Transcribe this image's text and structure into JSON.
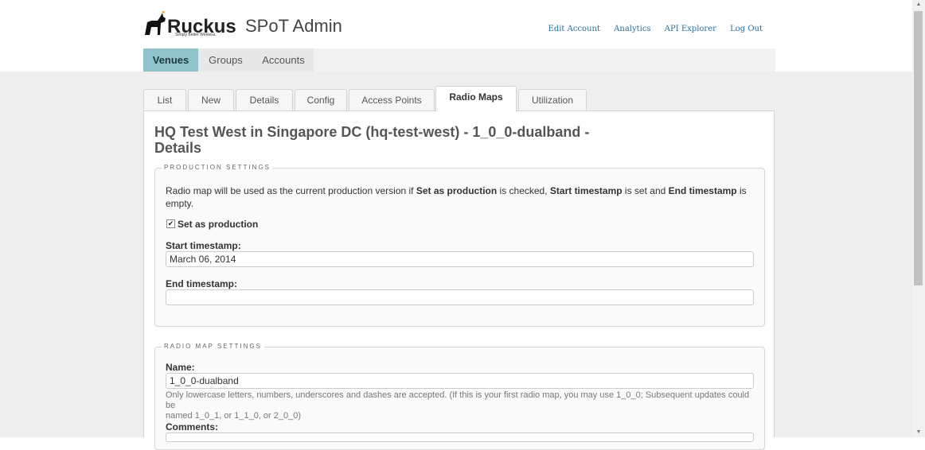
{
  "brand": {
    "logo_text": "Ruckus",
    "tagline": "Simply Better Wireless.",
    "app_title": "SPoT Admin"
  },
  "top_links": [
    "Edit Account",
    "Analytics",
    "API Explorer",
    "Log Out"
  ],
  "main_nav": {
    "tabs": [
      {
        "label": "Venues",
        "active": true
      },
      {
        "label": "Groups",
        "active": false
      },
      {
        "label": "Accounts",
        "active": false
      }
    ]
  },
  "sub_tabs": [
    {
      "label": "List",
      "active": false
    },
    {
      "label": "New",
      "active": false
    },
    {
      "label": "Details",
      "active": false
    },
    {
      "label": "Config",
      "active": false
    },
    {
      "label": "Access Points",
      "active": false
    },
    {
      "label": "Radio Maps",
      "active": true
    },
    {
      "label": "Utilization",
      "active": false
    }
  ],
  "page": {
    "title_line1": "HQ Test West in Singapore DC (hq-test-west) - 1_0_0-dualband -",
    "title_line2": "Details"
  },
  "production": {
    "legend": "PRODUCTION SETTINGS",
    "desc_part1": "Radio map will be used as the current production version if ",
    "desc_bold1": "Set as production",
    "desc_part2": " is checked, ",
    "desc_bold2": "Start timestamp",
    "desc_part3": " is set and ",
    "desc_bold3": "End timestamp",
    "desc_part4": " is",
    "desc_part5": "empty.",
    "checkbox_label": "Set as production",
    "checkbox_checked": true,
    "start_label": "Start timestamp:",
    "start_value": "March 06, 2014",
    "end_label": "End timestamp:",
    "end_value": ""
  },
  "radio_map": {
    "legend": "RADIO MAP SETTINGS",
    "name_label": "Name:",
    "name_value": "1_0_0-dualband",
    "help_line1": "Only lowercase letters, numbers, underscores and dashes are accepted. (If this is your first radio map, you may use 1_0_0; Subsequent updates could be",
    "help_line2": "named 1_0_1, or 1_1_0, or 2_0_0)",
    "comments_label": "Comments:"
  },
  "colors": {
    "accent_nav": "#8fc3c9",
    "link": "#2a6f9a",
    "page_bg": "#eeeeee"
  },
  "icons": [
    "ruckus-dog-logo-icon",
    "checkmark-icon",
    "scroll-up-icon",
    "scroll-down-icon"
  ]
}
